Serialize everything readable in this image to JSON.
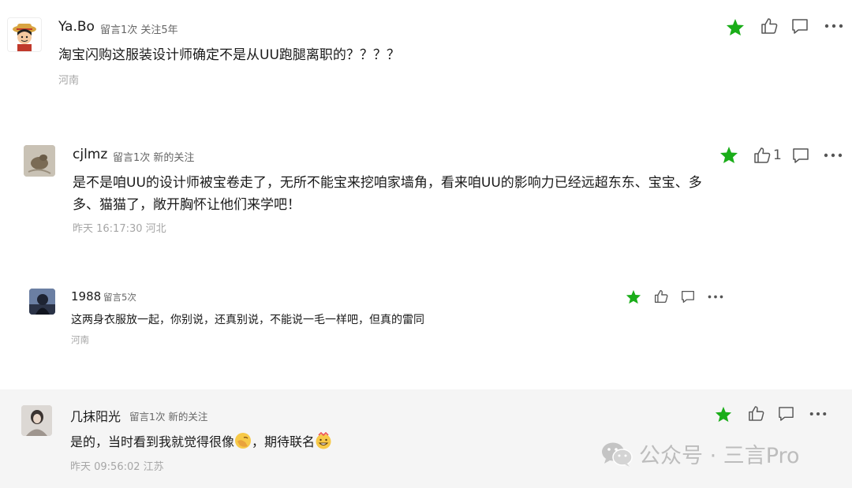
{
  "comments": [
    {
      "author": "Ya.Bo",
      "meta": "留言1次 关注5年",
      "text": "淘宝闪购这服装设计师确定不是从UU跑腿离职的？？？？",
      "info": "河南",
      "like_count": ""
    },
    {
      "author": "cjlmz",
      "meta": "留言1次 新的关注",
      "text_line1": "是不是咱UU的设计师被宝卷走了，无所不能宝来挖咱家墙角，看来咱UU的影响力已经远超东东、宝宝、多",
      "text_line2": "多、猫猫了，敞开胸怀让他们来学吧！",
      "info": "昨天 16:17:30 河北",
      "like_count": "1"
    },
    {
      "author": "1988",
      "meta": "留言5次",
      "text": "这两身衣服放一起，你别说，还真别说，不能说一毛一样吧，但真的雷同",
      "info": "河南",
      "like_count": ""
    },
    {
      "author": "几抹阳光",
      "meta": "留言1次 新的关注",
      "text_a": "是的，当时看到我就觉得很像",
      "text_b": "，期待联名",
      "info": "昨天 09:56:02 江苏",
      "like_count": ""
    }
  ],
  "icons": {
    "star": "star-icon",
    "like": "thumbs-up-icon",
    "reply": "comment-icon",
    "more": "more-icon",
    "wechat": "wechat-icon"
  },
  "colors": {
    "star": "#1aad19",
    "meta": "#666666",
    "info": "#a6a6a6",
    "highlight_bg": "#f5f5f5"
  },
  "watermark": "公众号 · 三言Pro"
}
